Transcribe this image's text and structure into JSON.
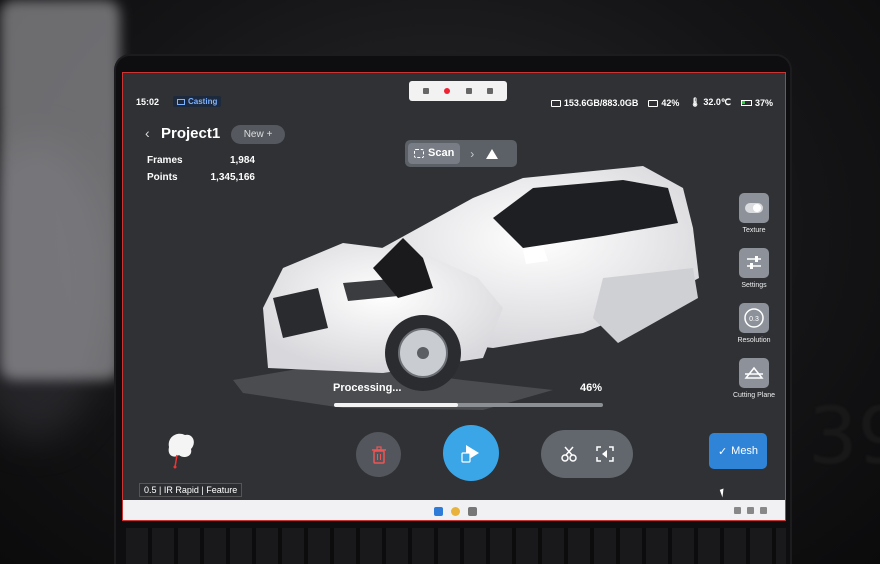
{
  "status": {
    "time": "15:02",
    "casting_label": "Casting",
    "storage": "153.6GB/883.0GB",
    "cpu": "42%",
    "temperature": "32.0℃",
    "battery": "37%"
  },
  "project": {
    "back_glyph": "‹",
    "name": "Project1",
    "new_label": "New +",
    "stats": [
      {
        "label": "Frames",
        "value": "1,984"
      },
      {
        "label": "Points",
        "value": "1,345,166"
      }
    ]
  },
  "scan_tabs": {
    "active": "Scan",
    "chevron": "›"
  },
  "tools": [
    {
      "label": "Texture",
      "icon": "toggle-icon"
    },
    {
      "label": "Settings",
      "icon": "sliders-icon"
    },
    {
      "label": "Resolution",
      "icon": "resolution-icon",
      "value": "0.3"
    },
    {
      "label": "Cutting Plane",
      "icon": "cutting-plane-icon"
    }
  ],
  "processing": {
    "label": "Processing...",
    "percent_text": "46%",
    "progress": 0.46
  },
  "actions": {
    "mesh_label": "Mesh",
    "mode_label": "0.5 | IR Rapid | Feature"
  },
  "colors": {
    "accent": "#3aa6e8",
    "mesh_button": "#2f84d8",
    "border": "#cc3333"
  }
}
